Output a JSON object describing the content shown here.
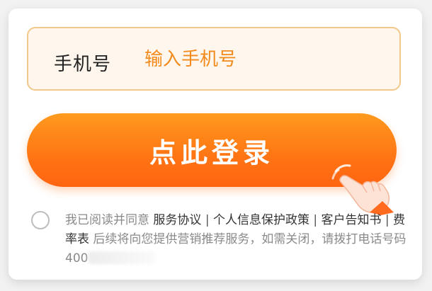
{
  "phone_field": {
    "label": "手机号",
    "placeholder": "输入手机号",
    "value": ""
  },
  "login_button": {
    "label": "点此登录"
  },
  "hand_pointer": {
    "icon": "pointing-hand-icon"
  },
  "agreement": {
    "prefix": "我已阅读并同意",
    "links": [
      "服务协议",
      "个人信息保护政策",
      "客户告知书",
      "费率表"
    ],
    "separator": "|",
    "notice": "后续将向您提供营销推荐服务，如需关闭，请拨打电话号码400"
  },
  "colors": {
    "accent": "#ff7414",
    "placeholder": "#f28a1c",
    "field_border": "#f2c78a",
    "field_bg": "#fff7ee"
  }
}
